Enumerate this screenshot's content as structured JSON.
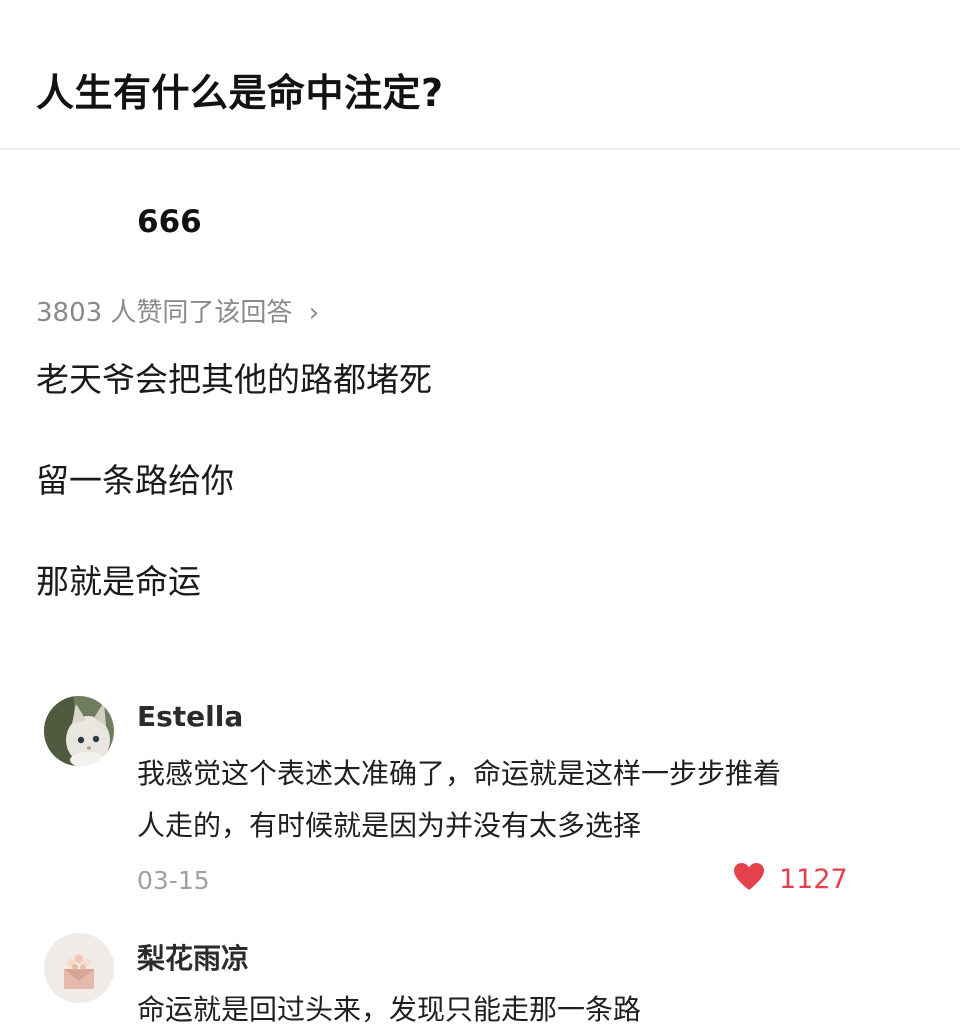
{
  "question": {
    "title": "人生有什么是命中注定?"
  },
  "answer": {
    "author": "666",
    "endorsement": "3803 人赞同了该回答",
    "endorsement_arrow": "›",
    "lines": [
      "老天爷会把其他的路都堵死",
      "留一条路给你",
      "那就是命运"
    ]
  },
  "comments": [
    {
      "author": "Estella",
      "avatar": "cat-avatar",
      "lines": [
        "我感觉这个表述太准确了，命运就是这样一步步推着",
        "人走的，有时候就是因为并没有太多选择"
      ],
      "date": "03-15",
      "likes": "1127",
      "like_icon": "heart-icon",
      "like_color": "#e5414d"
    },
    {
      "author": "梨花雨凉",
      "avatar": "flower-envelope-avatar",
      "lines": [
        "命运就是回过头来，发现只能走那一条路"
      ]
    }
  ]
}
